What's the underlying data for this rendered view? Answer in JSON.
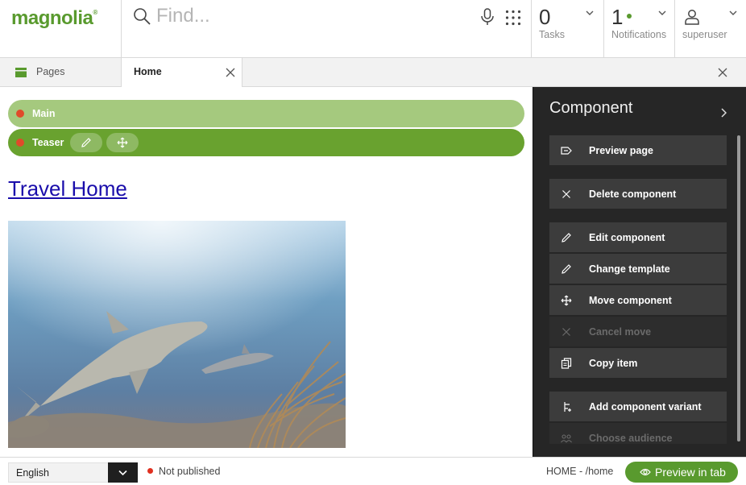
{
  "header": {
    "logo_text": "magnolia",
    "logo_mark": "®",
    "search_placeholder": "Find...",
    "tasks": {
      "count": "0",
      "label": "Tasks"
    },
    "notifications": {
      "count": "1",
      "label": "Notifications"
    },
    "user": {
      "label": "superuser"
    }
  },
  "tabs": {
    "pages_label": "Pages",
    "home_label": "Home"
  },
  "page": {
    "areas": [
      {
        "label": "Main"
      },
      {
        "label": "Teaser"
      }
    ],
    "link_text": "Travel Home"
  },
  "panel": {
    "title": "Component",
    "actions": [
      {
        "label": "Preview page",
        "icon": "preview-icon",
        "enabled": true
      },
      {
        "label": "Delete component",
        "icon": "close-icon",
        "enabled": true
      },
      {
        "label": "Edit component",
        "icon": "pencil-icon",
        "enabled": true
      },
      {
        "label": "Change template",
        "icon": "pencil-icon",
        "enabled": true
      },
      {
        "label": "Move component",
        "icon": "move-icon",
        "enabled": true
      },
      {
        "label": "Cancel move",
        "icon": "close-icon",
        "enabled": false
      },
      {
        "label": "Copy item",
        "icon": "copy-icon",
        "enabled": true
      },
      {
        "label": "Add component variant",
        "icon": "variant-icon",
        "enabled": true
      },
      {
        "label": "Choose audience",
        "icon": "audience-icon",
        "enabled": false
      }
    ]
  },
  "footer": {
    "language": "English",
    "status": "Not published",
    "path": "HOME - /home",
    "preview_button": "Preview in tab"
  },
  "colors": {
    "brand_green": "#599a2e",
    "area_main": "#a5c97e",
    "area_teaser": "#69a22f",
    "panel_bg": "#262626",
    "status_red": "#e03020"
  }
}
